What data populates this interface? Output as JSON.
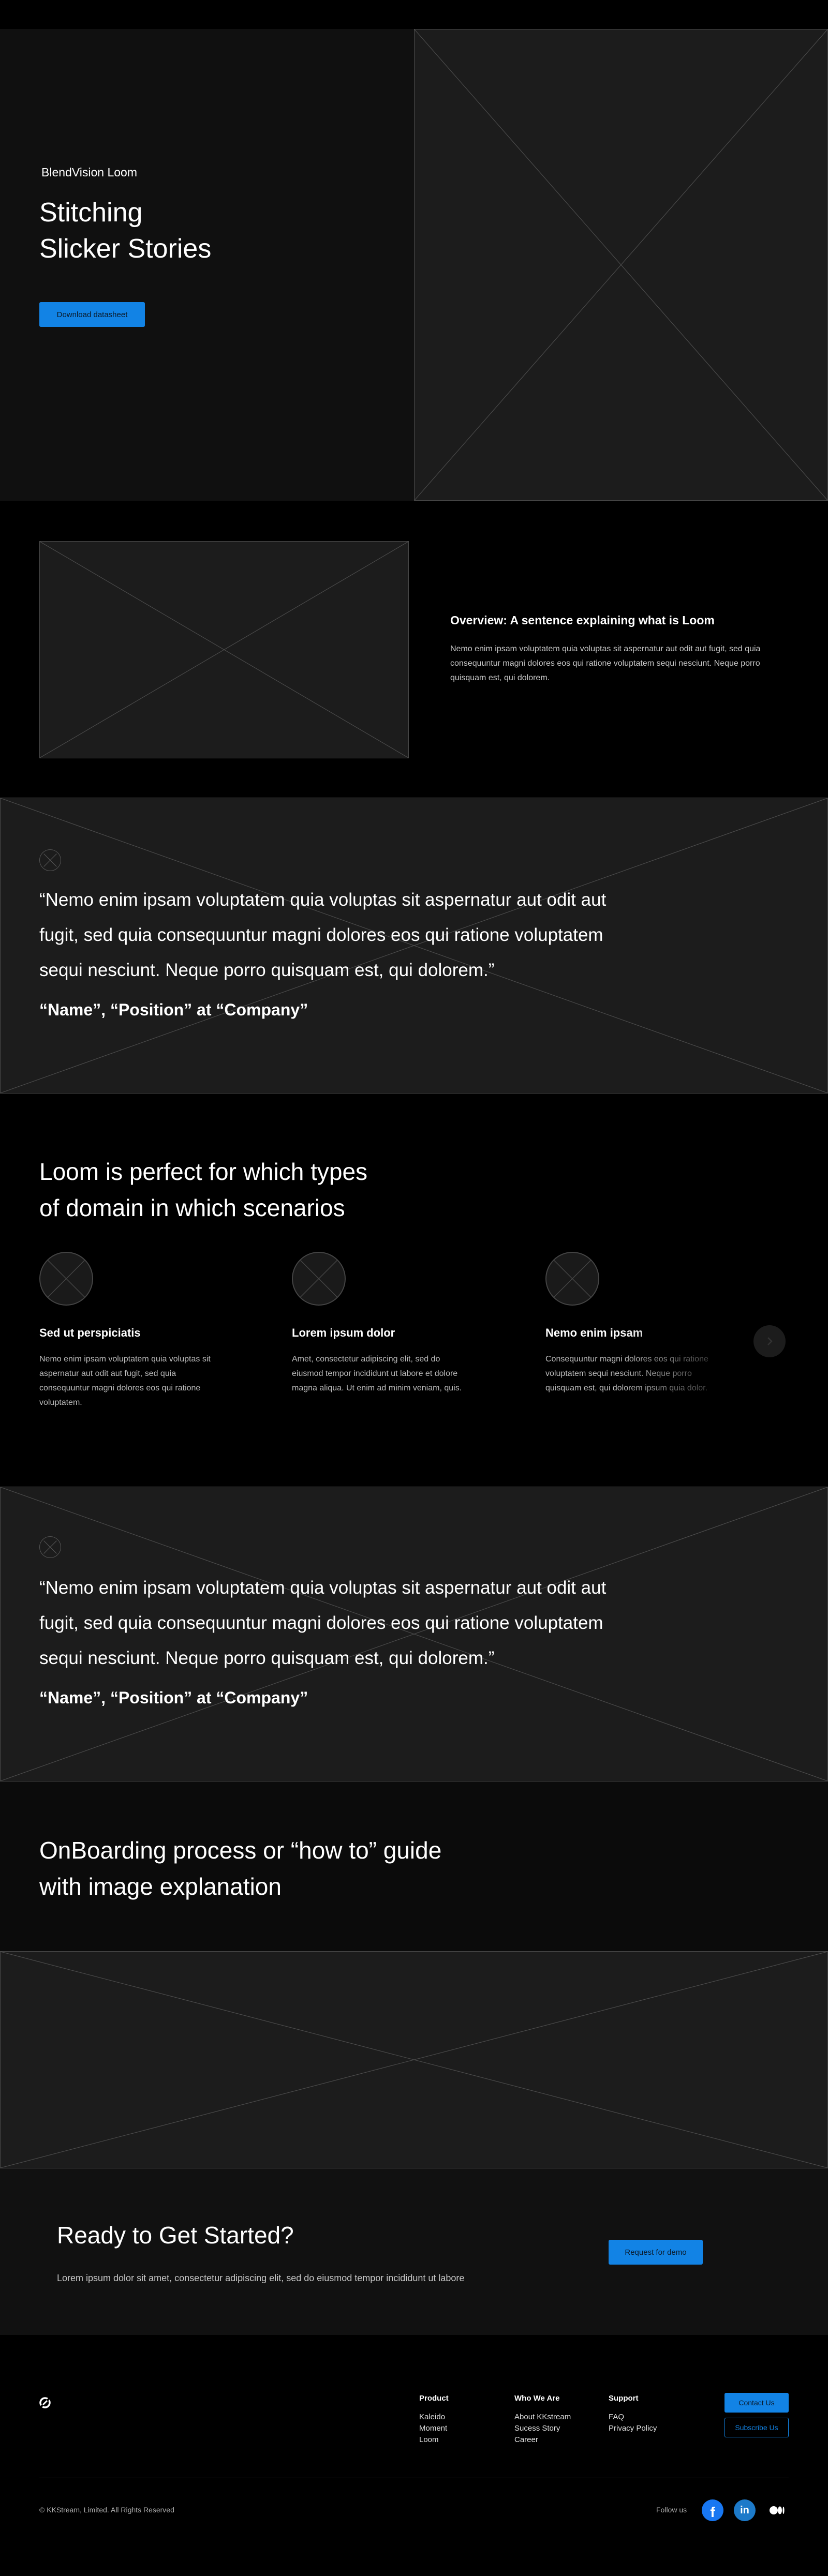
{
  "hero": {
    "brand": "BlendVision Loom",
    "title_line1": "Stitching",
    "title_line2": "Slicker Stories",
    "cta": "Download datasheet"
  },
  "overview": {
    "heading": "Overview: A sentence explaining what is Loom",
    "text": "Nemo enim ipsam voluptatem quia voluptas sit aspernatur aut odit aut fugit, sed quia consequuntur magni dolores eos qui ratione voluptatem sequi nesciunt. Neque porro quisquam est, qui dolorem."
  },
  "testimonial1": {
    "line1": "“Nemo enim ipsam voluptatem quia voluptas sit aspernatur aut odit aut",
    "line2": "fugit, sed quia consequuntur magni dolores eos qui ratione voluptatem",
    "line3": "sequi nesciunt. Neque porro quisquam est, qui dolorem.”",
    "name": "“Name”, “Position” at “Company”"
  },
  "domains": {
    "heading_line1": "Loom is perfect for which types",
    "heading_line2": "of domain in which scenarios",
    "cards": [
      {
        "title": "Sed ut perspiciatis",
        "text": "Nemo enim ipsam voluptatem quia voluptas sit aspernatur aut odit aut fugit, sed quia consequuntur magni dolores eos qui ratione voluptatem."
      },
      {
        "title": "Lorem ipsum dolor",
        "text": "Amet, consectetur adipiscing elit, sed do eiusmod tempor incididunt ut labore et dolore magna aliqua. Ut enim ad minim veniam, quis."
      },
      {
        "title": "Nemo enim ipsam",
        "text": "Consequuntur magni dolores eos qui ratione voluptatem sequi nesciunt. Neque porro quisquam est, qui dolorem ipsum quia dolor."
      }
    ]
  },
  "testimonial2": {
    "line1": "“Nemo enim ipsam voluptatem quia voluptas sit aspernatur aut odit aut",
    "line2": "fugit, sed quia consequuntur magni dolores eos qui ratione voluptatem",
    "line3": "sequi nesciunt. Neque porro quisquam est, qui dolorem.”",
    "name": "“Name”, “Position” at “Company”"
  },
  "onboarding": {
    "heading_line1": "OnBoarding process or “how to” guide",
    "heading_line2": "with image explanation"
  },
  "cta_section": {
    "heading": "Ready to Get Started?",
    "text": "Lorem ipsum dolor sit amet, consectetur adipiscing elit, sed do eiusmod tempor incididunt ut labore",
    "button": "Request for demo"
  },
  "footer": {
    "columns": [
      {
        "heading": "Product",
        "links": [
          "Kaleido",
          "Moment",
          "Loom"
        ]
      },
      {
        "heading": "Who We Are",
        "links": [
          "About KKstream",
          "Sucess Story",
          "Career"
        ]
      },
      {
        "heading": "Support",
        "links": [
          "FAQ",
          "Privacy Policy"
        ]
      }
    ],
    "contact_button": "Contact Us",
    "subscribe_button": "Subscribe Us",
    "copyright": "© KKStream, Limited. All Rights Reserved",
    "follow_label": "Follow us",
    "socials": [
      "facebook-icon",
      "linkedin-icon",
      "medium-icon"
    ]
  },
  "colors": {
    "accent": "#1283e5",
    "background": "#000000",
    "panel": "#1c1c1c"
  }
}
